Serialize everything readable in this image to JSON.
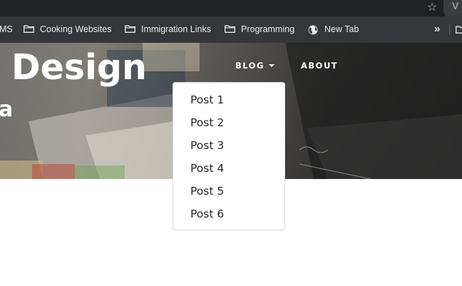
{
  "browser": {
    "bookmark_star_icon": "star-outline-icon",
    "extension_icon": "v-extension-icon",
    "extension_letter": "V"
  },
  "bookmarks": {
    "items": [
      {
        "label": "MS",
        "icon": "none"
      },
      {
        "label": "Cooking Websites",
        "icon": "folder-icon"
      },
      {
        "label": "Immigration Links",
        "icon": "folder-icon"
      },
      {
        "label": "Programming",
        "icon": "folder-icon"
      },
      {
        "label": "New Tab",
        "icon": "globe-icon"
      }
    ],
    "overflow_label": "»"
  },
  "hero": {
    "title": "Design",
    "subtitle": "a"
  },
  "nav": {
    "blog_label": "BLOG",
    "about_label": "ABOUT"
  },
  "dropdown": {
    "items": [
      "Post 1",
      "Post 2",
      "Post 3",
      "Post 4",
      "Post 5",
      "Post 6"
    ]
  },
  "colors": {
    "browser_bar": "#202124",
    "bookmarks_bar": "#35363a",
    "bookmark_text": "#e8eaed",
    "dropdown_text": "#212529"
  }
}
